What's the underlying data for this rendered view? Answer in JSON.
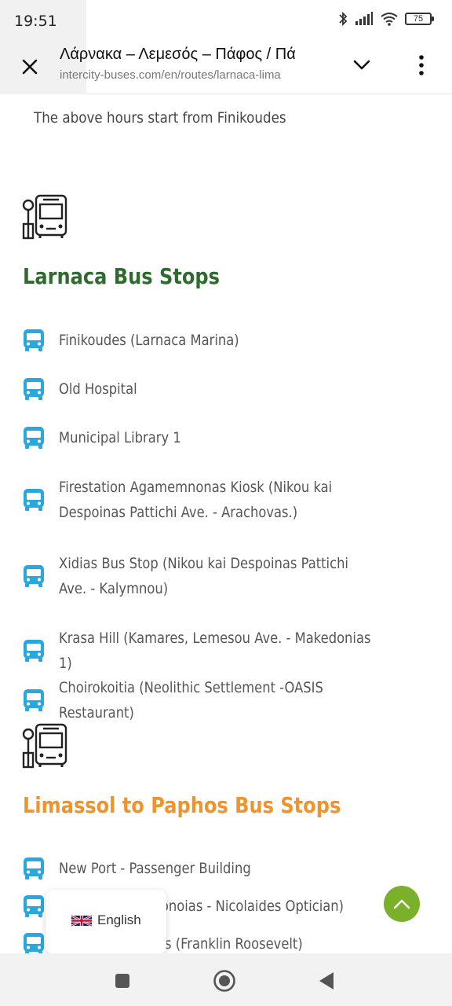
{
  "status_bar": {
    "time": "19:51",
    "battery": "75",
    "icons": [
      "bluetooth-icon",
      "signal-icon",
      "wifi-icon",
      "battery-icon"
    ]
  },
  "browser": {
    "tab_title": "Λάρνακα – Λεμεσός – Πάφος / Πά",
    "url": "intercity-buses.com/en/routes/larnaca-lima",
    "icons": [
      "close-icon",
      "chevron-down-icon",
      "more-vert-icon"
    ]
  },
  "page": {
    "intro": "The above hours start from Finikoudes",
    "sections": [
      {
        "title": "Larnaca Bus Stops",
        "color": "#2f6b2f",
        "stops": [
          "Finikoudes (Larnaca Marina)",
          "Old Hospital",
          "Municipal Library 1",
          "Firestation Agamemnonas Kiosk (Nikou kai Despoinas Pattichi Ave. - Arachovas.)",
          "Xidias Bus Stop (Nikou kai Despoinas Pattichi Ave. - Kalymnou)",
          "Krasa Hill (Kamares, Lemesou Ave. - Makedonias 1)",
          "Choirokoitia (Neolithic Settlement -OASIS Restaurant)"
        ]
      },
      {
        "title": "Limassol to Paphos Bus Stops",
        "color": "#f0932b",
        "stops": [
          "New Port - Passenger Building",
          "monoias - Nicolaides Optician)",
          "s (Franklin Roosevelt)"
        ]
      }
    ],
    "bus_icon_color": "#29a8e0"
  },
  "floating": {
    "language": "English",
    "scroll_top_color": "#7bb12a"
  },
  "nav": {
    "icons": [
      "recents-square-icon",
      "home-circle-icon",
      "back-triangle-icon"
    ]
  }
}
